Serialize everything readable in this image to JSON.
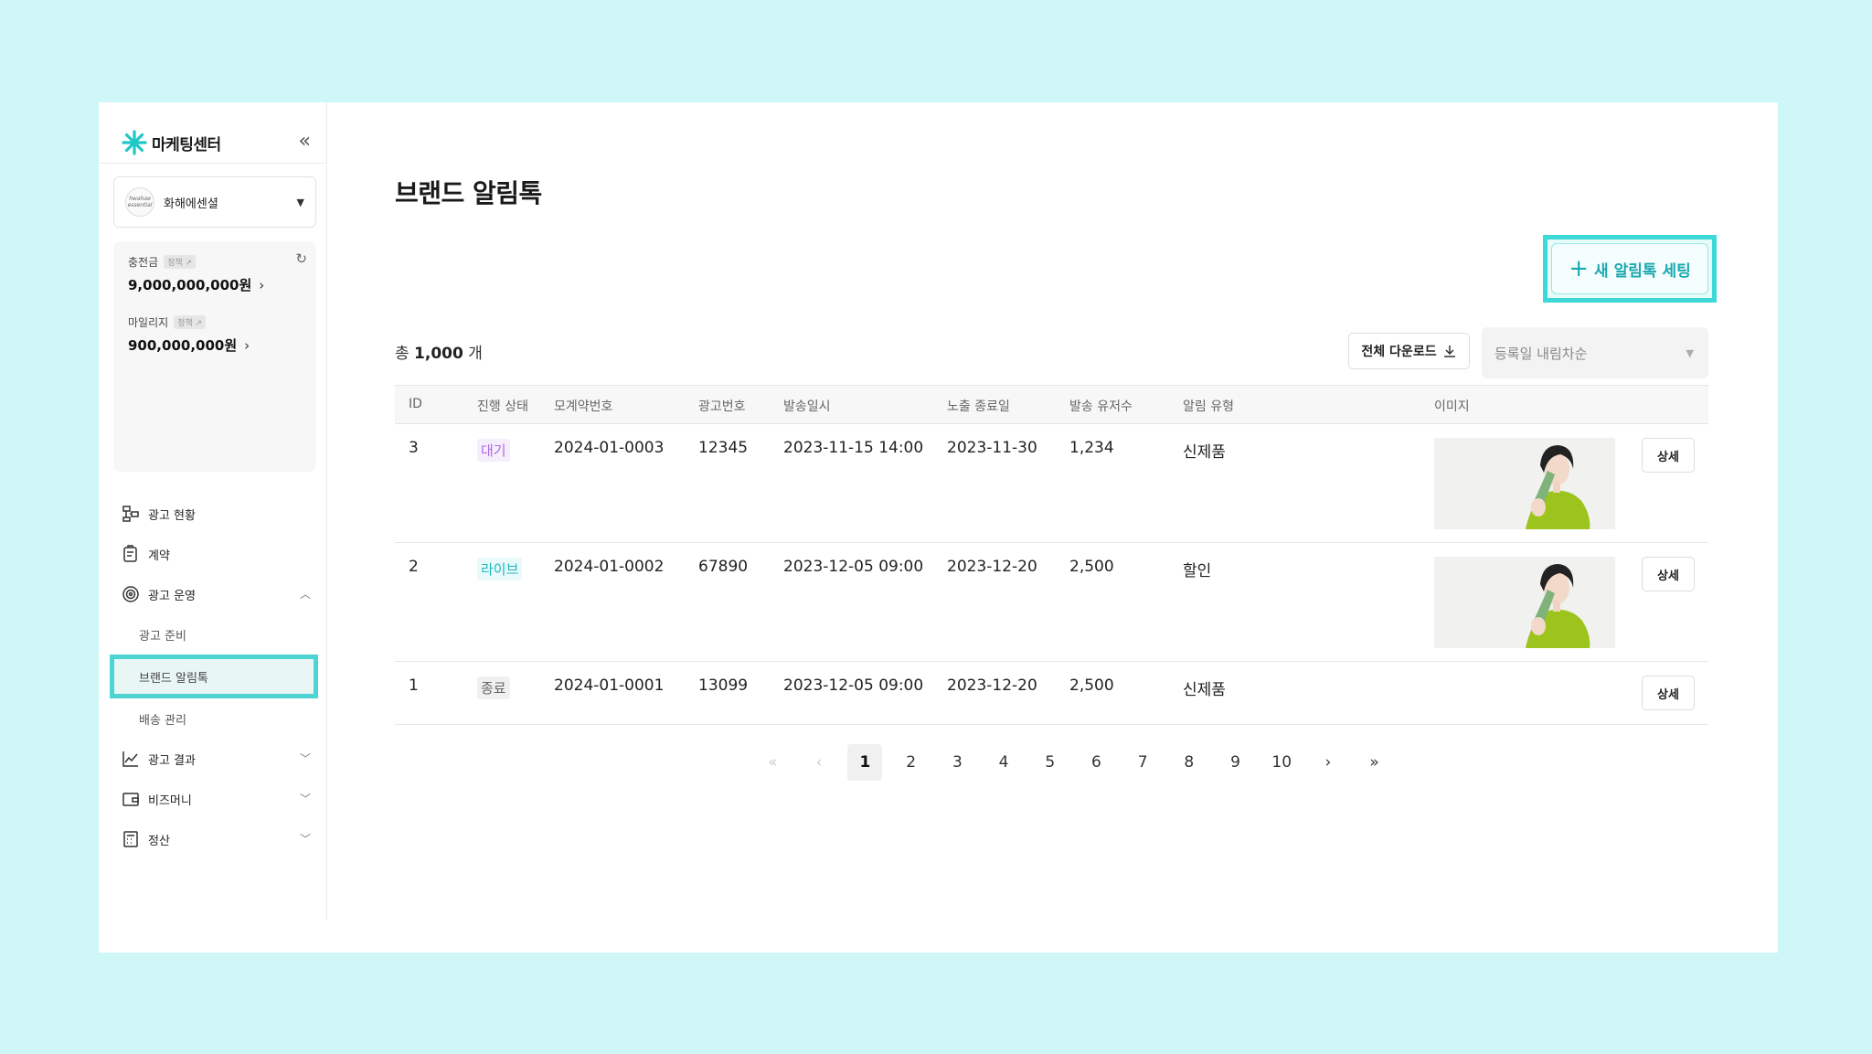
{
  "sidebar": {
    "logo_text": "마케팅센터",
    "collapse_icon": "«",
    "brand": {
      "logo_text": "hwahae essential",
      "name": "화해에센셜"
    },
    "balance": {
      "charge_label": "충전금",
      "charge_policy": "정책",
      "charge_value": "9,000,000,000원",
      "mileage_label": "마일리지",
      "mileage_policy": "정책",
      "mileage_value": "900,000,000원"
    },
    "nav": {
      "ad_status": "광고 현황",
      "contract": "계약",
      "ad_operation": "광고 운영",
      "ad_prep": "광고 준비",
      "brand_alimtalk": "브랜드 알림톡",
      "delivery": "배송 관리",
      "ad_result": "광고 결과",
      "bizmoney": "비즈머니",
      "settlement": "정산"
    }
  },
  "main": {
    "title": "브랜드 알림톡",
    "new_button": "새 알림톡 세팅",
    "total_prefix": "총",
    "total_count": "1,000",
    "total_suffix": "개",
    "download_button": "전체 다운로드",
    "sort_value": "등록일 내림차순",
    "table": {
      "headers": {
        "id": "ID",
        "status": "진행 상태",
        "contract_no": "모계약번호",
        "ad_no": "광고번호",
        "send_datetime": "발송일시",
        "expose_end": "노출 종료일",
        "users": "발송 유저수",
        "type": "알림 유형",
        "image": "이미지"
      },
      "rows": [
        {
          "id": "3",
          "status": "대기",
          "contract_no": "2024-01-0003",
          "ad_no": "12345",
          "send_datetime": "2023-11-15 14:00",
          "expose_end": "2023-11-30",
          "users": "1,234",
          "type": "신제품",
          "detail": "상세"
        },
        {
          "id": "2",
          "status": "라이브",
          "contract_no": "2024-01-0002",
          "ad_no": "67890",
          "send_datetime": "2023-12-05 09:00",
          "expose_end": "2023-12-20",
          "users": "2,500",
          "type": "할인",
          "detail": "상세"
        },
        {
          "id": "1",
          "status": "종료",
          "contract_no": "2024-01-0001",
          "ad_no": "13099",
          "send_datetime": "2023-12-05 09:00",
          "expose_end": "2023-12-20",
          "users": "2,500",
          "type": "신제품",
          "detail": "상세"
        }
      ]
    },
    "pagination": {
      "first": "«",
      "prev": "‹",
      "pages": [
        "1",
        "2",
        "3",
        "4",
        "5",
        "6",
        "7",
        "8",
        "9",
        "10"
      ],
      "current_page": 1,
      "next": "›",
      "last": "»"
    }
  },
  "colors": {
    "background": "#d0f7f7",
    "accent": "#1aa8b0",
    "highlight_border": "#3dd8d8",
    "status_wait": "#b067e8",
    "status_live": "#1db8c2"
  }
}
